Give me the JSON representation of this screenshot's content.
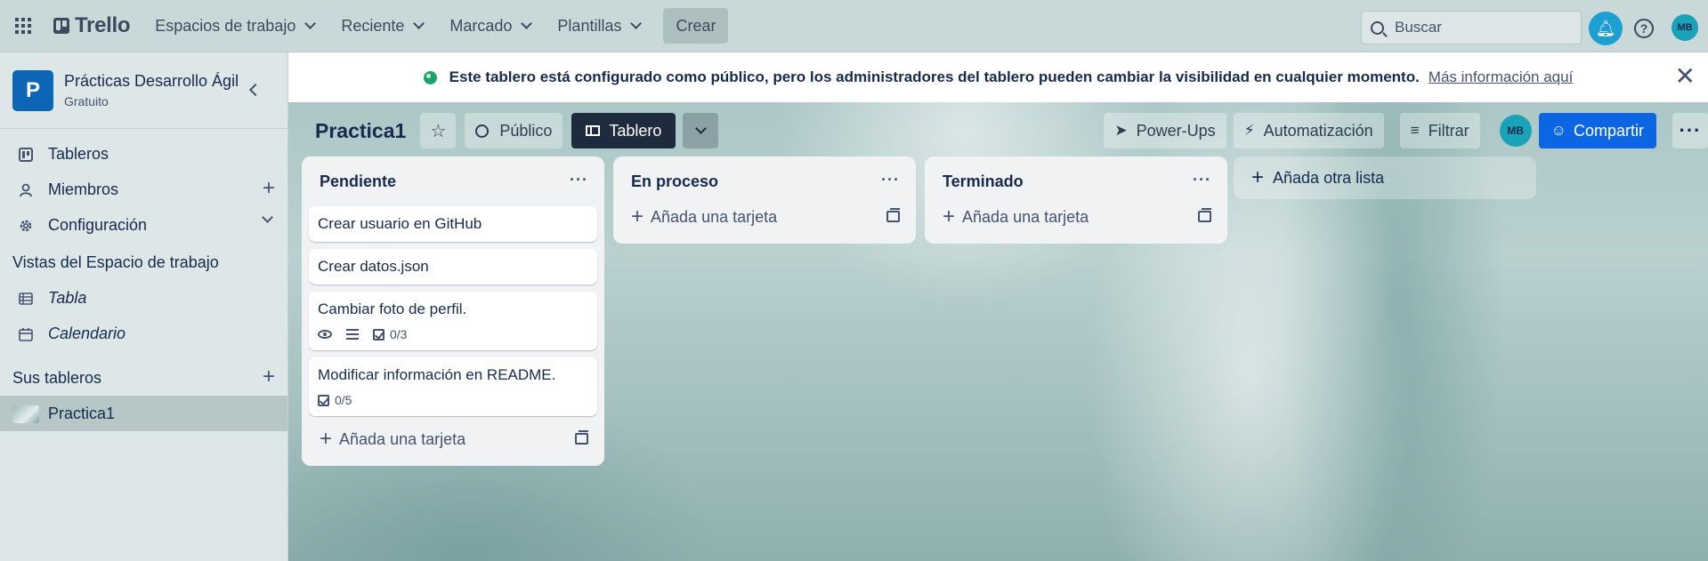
{
  "header": {
    "logo_text": "Trello",
    "nav": [
      {
        "label": "Espacios de trabajo"
      },
      {
        "label": "Reciente"
      },
      {
        "label": "Marcado"
      },
      {
        "label": "Plantillas"
      }
    ],
    "create_label": "Crear",
    "search_placeholder": "Buscar",
    "avatar_initials": "MB"
  },
  "sidebar": {
    "workspace_initial": "P",
    "workspace_name": "Prácticas Desarrollo Ágil",
    "workspace_plan": "Gratuito",
    "items": [
      {
        "label": "Tableros"
      },
      {
        "label": "Miembros"
      },
      {
        "label": "Configuración"
      }
    ],
    "views_title": "Vistas del Espacio de trabajo",
    "views": [
      {
        "label": "Tabla"
      },
      {
        "label": "Calendario"
      }
    ],
    "boards_title": "Sus tableros",
    "boards": [
      {
        "label": "Practica1"
      }
    ]
  },
  "banner": {
    "message": "Este tablero está configurado como público, pero los administradores del tablero pueden cambiar la visibilidad en cualquier momento.",
    "link": "Más información aquí"
  },
  "board": {
    "title": "Practica1",
    "visibility": "Público",
    "view_tab": "Tablero",
    "powerups": "Power-Ups",
    "automation": "Automatización",
    "filter": "Filtrar",
    "member_initials": "MB",
    "share": "Compartir",
    "add_list": "Añada otra lista",
    "add_card": "Añada una tarjeta",
    "lists": [
      {
        "title": "Pendiente",
        "cards": [
          {
            "title": "Crear usuario en GitHub"
          },
          {
            "title": "Crear datos.json"
          },
          {
            "title": "Cambiar foto de perfil.",
            "checklist": "0/3"
          },
          {
            "title": "Modificar información en README.",
            "checklist": "0/5"
          }
        ]
      },
      {
        "title": "En proceso",
        "cards": []
      },
      {
        "title": "Terminado",
        "cards": []
      }
    ]
  },
  "colors": {
    "primary": "#0c66e4",
    "workspace_logo": "#0c66b5",
    "avatar": "#1aa3b8",
    "public_globe": "#22a06b"
  }
}
